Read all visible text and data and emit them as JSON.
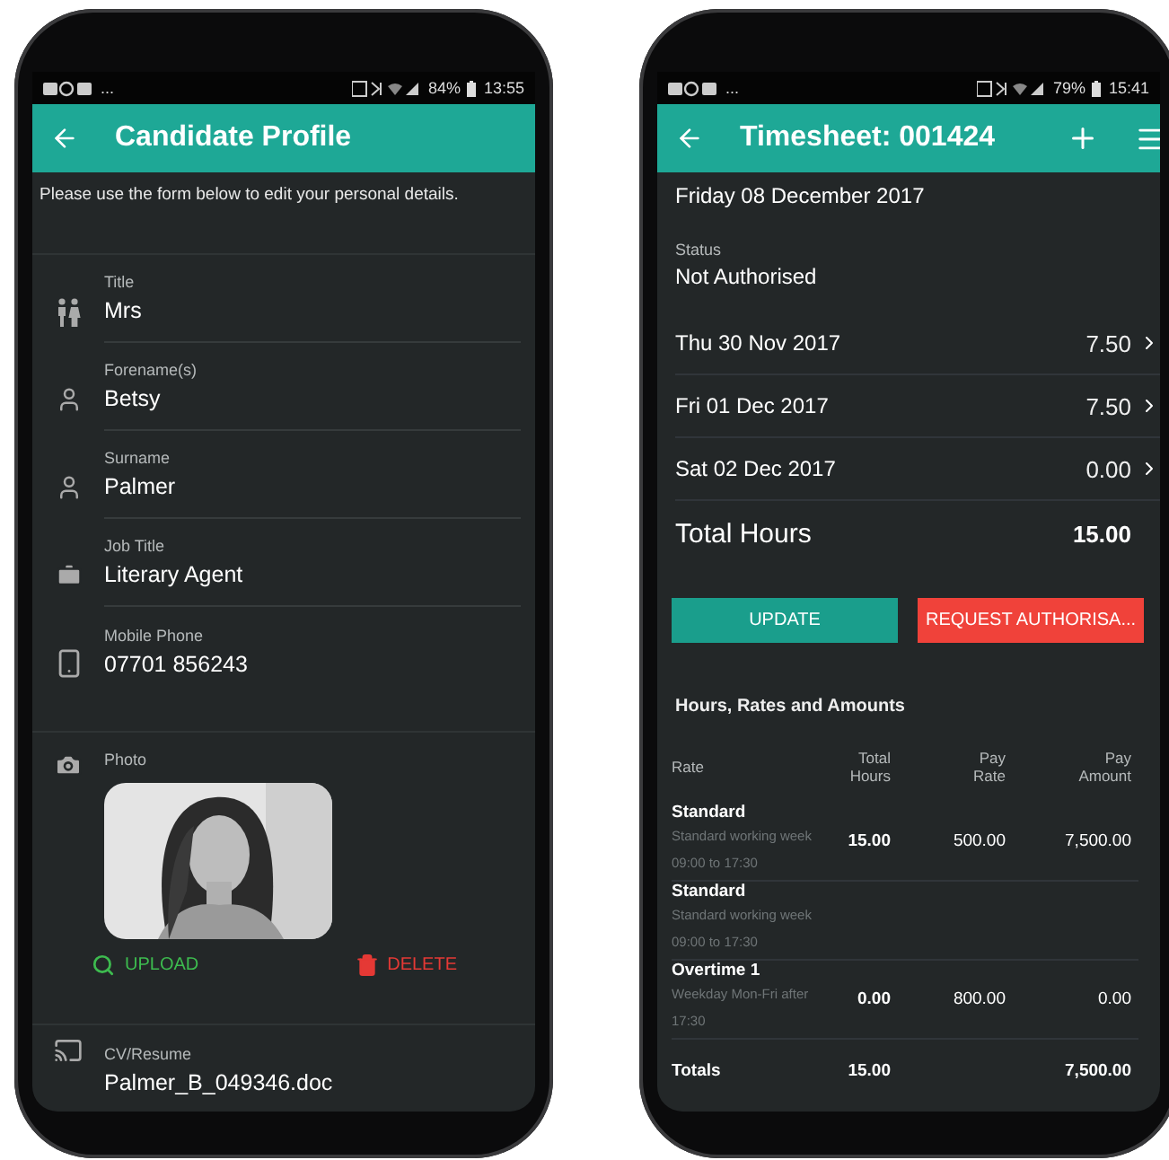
{
  "profile_phone": {
    "status_bar": {
      "notifications": "...",
      "battery": "84%",
      "time": "13:55"
    },
    "app_bar": {
      "title": "Candidate Profile"
    },
    "intro": "Please use the form below to edit your personal details.",
    "fields": [
      {
        "kind": "people",
        "label": "Title",
        "value": "Mrs"
      },
      {
        "kind": "person",
        "label": "Forename(s)",
        "value": "Betsy"
      },
      {
        "kind": "person",
        "label": "Surname",
        "value": "Palmer"
      },
      {
        "kind": "briefcase",
        "label": "Job Title",
        "value": "Literary Agent"
      },
      {
        "kind": "phone",
        "label": "Mobile Phone",
        "value": "07701 856243"
      }
    ],
    "photo": {
      "label": "Photo",
      "kind": "picture"
    },
    "photo_actions": [
      {
        "kind": "upload",
        "label": "UPLOAD"
      },
      {
        "kind": "delete",
        "label": "DELETE"
      }
    ],
    "cv": {
      "label": "CV/Resume",
      "value": "Palmer_B_049346.doc"
    }
  },
  "timesheet_phone": {
    "status_bar": {
      "notifications": "...",
      "battery": "79%",
      "time": "15:41"
    },
    "app_bar": {
      "title": "Timesheet: 001424"
    },
    "input_date": "Friday 08 December 2017",
    "status": {
      "label": "Status",
      "value": "Not Authorised"
    },
    "days": [
      {
        "date": "Thu 30 Nov 2017",
        "hours": "7.50"
      },
      {
        "date": "Fri 01 Dec 2017",
        "hours": "7.50"
      },
      {
        "date": "Sat 02 Dec 2017",
        "hours": "0.00"
      }
    ],
    "total": {
      "label": "Total Hours",
      "value": "15.00"
    },
    "buttons": [
      {
        "kind": "update",
        "label": "UPDATE"
      },
      {
        "kind": "request",
        "label": "REQUEST AUTHORISA..."
      }
    ],
    "section_title": "Hours, Rates and Amounts",
    "table": {
      "columns": [
        "Rate",
        "Total Hours",
        "Pay Rate",
        "Pay Amount"
      ],
      "rows": [
        {
          "name": "Standard",
          "description": "Standard working week 09:00 to 17:30",
          "hours": "15.00",
          "rate": "500.00",
          "amount": "7,500.00"
        },
        {
          "name": "Standard",
          "description": "Standard working week 09:00 to 17:30"
        },
        {
          "name": "Overtime 1",
          "description": "Weekday Mon-Fri after 17:30",
          "hours": "0.00",
          "rate": "800.00",
          "amount": "0.00"
        }
      ],
      "totals": {
        "label": "Totals",
        "hours": "15.00",
        "amount": "7,500.00"
      }
    }
  }
}
